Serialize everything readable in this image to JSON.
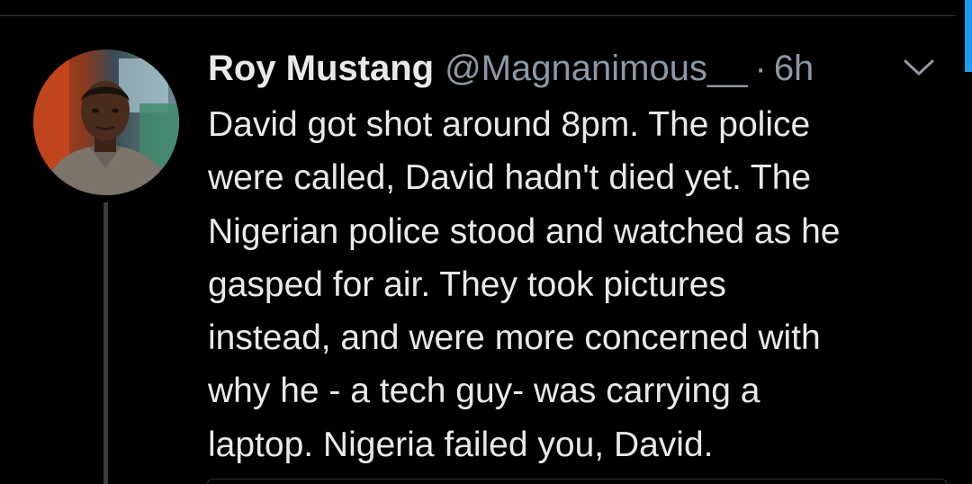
{
  "tweet": {
    "author": {
      "display_name": "Roy Mustang",
      "handle": "@Magnanimous__"
    },
    "separator": "·",
    "timestamp": "6h",
    "text_lines": [
      "David got shot around 8pm. The police",
      "were called, David hadn't died yet. The",
      "Nigerian police stood and watched as he",
      "gasped for air. They took pictures",
      "instead, and were more concerned with",
      "why he - a tech guy- was carrying a",
      "laptop. Nigeria failed you, David."
    ]
  },
  "icons": {
    "menu": "chevron-down-icon"
  },
  "colors": {
    "background": "#000000",
    "text_primary": "#e7e9ea",
    "text_secondary": "#8b98a5",
    "divider": "#2f3336",
    "accent": "#1d9bf0"
  }
}
